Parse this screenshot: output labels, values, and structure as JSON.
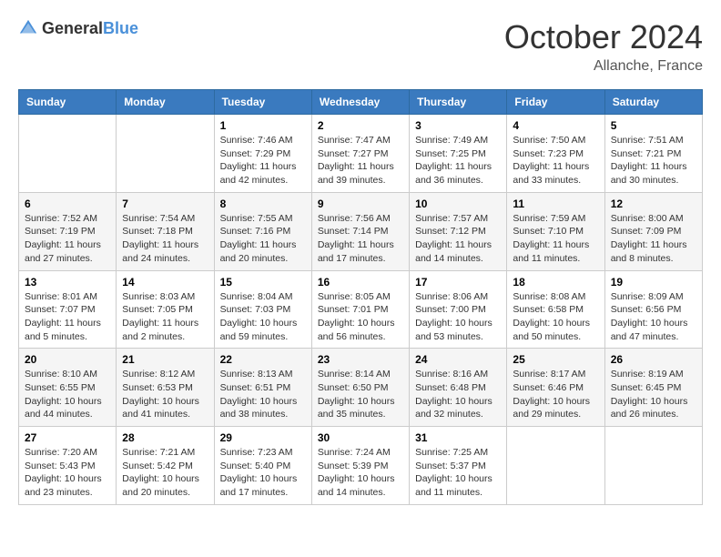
{
  "header": {
    "logo_general": "General",
    "logo_blue": "Blue",
    "month": "October 2024",
    "location": "Allanche, France"
  },
  "days_of_week": [
    "Sunday",
    "Monday",
    "Tuesday",
    "Wednesday",
    "Thursday",
    "Friday",
    "Saturday"
  ],
  "weeks": [
    [
      {
        "day": "",
        "sunrise": "",
        "sunset": "",
        "daylight": ""
      },
      {
        "day": "",
        "sunrise": "",
        "sunset": "",
        "daylight": ""
      },
      {
        "day": "1",
        "sunrise": "Sunrise: 7:46 AM",
        "sunset": "Sunset: 7:29 PM",
        "daylight": "Daylight: 11 hours and 42 minutes."
      },
      {
        "day": "2",
        "sunrise": "Sunrise: 7:47 AM",
        "sunset": "Sunset: 7:27 PM",
        "daylight": "Daylight: 11 hours and 39 minutes."
      },
      {
        "day": "3",
        "sunrise": "Sunrise: 7:49 AM",
        "sunset": "Sunset: 7:25 PM",
        "daylight": "Daylight: 11 hours and 36 minutes."
      },
      {
        "day": "4",
        "sunrise": "Sunrise: 7:50 AM",
        "sunset": "Sunset: 7:23 PM",
        "daylight": "Daylight: 11 hours and 33 minutes."
      },
      {
        "day": "5",
        "sunrise": "Sunrise: 7:51 AM",
        "sunset": "Sunset: 7:21 PM",
        "daylight": "Daylight: 11 hours and 30 minutes."
      }
    ],
    [
      {
        "day": "6",
        "sunrise": "Sunrise: 7:52 AM",
        "sunset": "Sunset: 7:19 PM",
        "daylight": "Daylight: 11 hours and 27 minutes."
      },
      {
        "day": "7",
        "sunrise": "Sunrise: 7:54 AM",
        "sunset": "Sunset: 7:18 PM",
        "daylight": "Daylight: 11 hours and 24 minutes."
      },
      {
        "day": "8",
        "sunrise": "Sunrise: 7:55 AM",
        "sunset": "Sunset: 7:16 PM",
        "daylight": "Daylight: 11 hours and 20 minutes."
      },
      {
        "day": "9",
        "sunrise": "Sunrise: 7:56 AM",
        "sunset": "Sunset: 7:14 PM",
        "daylight": "Daylight: 11 hours and 17 minutes."
      },
      {
        "day": "10",
        "sunrise": "Sunrise: 7:57 AM",
        "sunset": "Sunset: 7:12 PM",
        "daylight": "Daylight: 11 hours and 14 minutes."
      },
      {
        "day": "11",
        "sunrise": "Sunrise: 7:59 AM",
        "sunset": "Sunset: 7:10 PM",
        "daylight": "Daylight: 11 hours and 11 minutes."
      },
      {
        "day": "12",
        "sunrise": "Sunrise: 8:00 AM",
        "sunset": "Sunset: 7:09 PM",
        "daylight": "Daylight: 11 hours and 8 minutes."
      }
    ],
    [
      {
        "day": "13",
        "sunrise": "Sunrise: 8:01 AM",
        "sunset": "Sunset: 7:07 PM",
        "daylight": "Daylight: 11 hours and 5 minutes."
      },
      {
        "day": "14",
        "sunrise": "Sunrise: 8:03 AM",
        "sunset": "Sunset: 7:05 PM",
        "daylight": "Daylight: 11 hours and 2 minutes."
      },
      {
        "day": "15",
        "sunrise": "Sunrise: 8:04 AM",
        "sunset": "Sunset: 7:03 PM",
        "daylight": "Daylight: 10 hours and 59 minutes."
      },
      {
        "day": "16",
        "sunrise": "Sunrise: 8:05 AM",
        "sunset": "Sunset: 7:01 PM",
        "daylight": "Daylight: 10 hours and 56 minutes."
      },
      {
        "day": "17",
        "sunrise": "Sunrise: 8:06 AM",
        "sunset": "Sunset: 7:00 PM",
        "daylight": "Daylight: 10 hours and 53 minutes."
      },
      {
        "day": "18",
        "sunrise": "Sunrise: 8:08 AM",
        "sunset": "Sunset: 6:58 PM",
        "daylight": "Daylight: 10 hours and 50 minutes."
      },
      {
        "day": "19",
        "sunrise": "Sunrise: 8:09 AM",
        "sunset": "Sunset: 6:56 PM",
        "daylight": "Daylight: 10 hours and 47 minutes."
      }
    ],
    [
      {
        "day": "20",
        "sunrise": "Sunrise: 8:10 AM",
        "sunset": "Sunset: 6:55 PM",
        "daylight": "Daylight: 10 hours and 44 minutes."
      },
      {
        "day": "21",
        "sunrise": "Sunrise: 8:12 AM",
        "sunset": "Sunset: 6:53 PM",
        "daylight": "Daylight: 10 hours and 41 minutes."
      },
      {
        "day": "22",
        "sunrise": "Sunrise: 8:13 AM",
        "sunset": "Sunset: 6:51 PM",
        "daylight": "Daylight: 10 hours and 38 minutes."
      },
      {
        "day": "23",
        "sunrise": "Sunrise: 8:14 AM",
        "sunset": "Sunset: 6:50 PM",
        "daylight": "Daylight: 10 hours and 35 minutes."
      },
      {
        "day": "24",
        "sunrise": "Sunrise: 8:16 AM",
        "sunset": "Sunset: 6:48 PM",
        "daylight": "Daylight: 10 hours and 32 minutes."
      },
      {
        "day": "25",
        "sunrise": "Sunrise: 8:17 AM",
        "sunset": "Sunset: 6:46 PM",
        "daylight": "Daylight: 10 hours and 29 minutes."
      },
      {
        "day": "26",
        "sunrise": "Sunrise: 8:19 AM",
        "sunset": "Sunset: 6:45 PM",
        "daylight": "Daylight: 10 hours and 26 minutes."
      }
    ],
    [
      {
        "day": "27",
        "sunrise": "Sunrise: 7:20 AM",
        "sunset": "Sunset: 5:43 PM",
        "daylight": "Daylight: 10 hours and 23 minutes."
      },
      {
        "day": "28",
        "sunrise": "Sunrise: 7:21 AM",
        "sunset": "Sunset: 5:42 PM",
        "daylight": "Daylight: 10 hours and 20 minutes."
      },
      {
        "day": "29",
        "sunrise": "Sunrise: 7:23 AM",
        "sunset": "Sunset: 5:40 PM",
        "daylight": "Daylight: 10 hours and 17 minutes."
      },
      {
        "day": "30",
        "sunrise": "Sunrise: 7:24 AM",
        "sunset": "Sunset: 5:39 PM",
        "daylight": "Daylight: 10 hours and 14 minutes."
      },
      {
        "day": "31",
        "sunrise": "Sunrise: 7:25 AM",
        "sunset": "Sunset: 5:37 PM",
        "daylight": "Daylight: 10 hours and 11 minutes."
      },
      {
        "day": "",
        "sunrise": "",
        "sunset": "",
        "daylight": ""
      },
      {
        "day": "",
        "sunrise": "",
        "sunset": "",
        "daylight": ""
      }
    ]
  ]
}
